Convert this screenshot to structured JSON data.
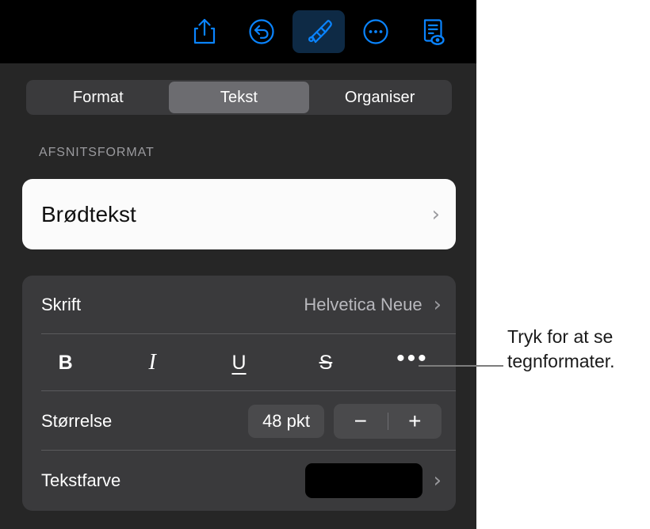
{
  "toolbar": {
    "buttons": [
      {
        "name": "share-icon",
        "label": "Del"
      },
      {
        "name": "undo-icon",
        "label": "Fortryd"
      },
      {
        "name": "paintbrush-icon",
        "label": "Format",
        "selected": true
      },
      {
        "name": "more-circle-icon",
        "label": "Mere"
      },
      {
        "name": "document-view-icon",
        "label": "Dokumentvisning"
      }
    ]
  },
  "segmented": {
    "options": [
      "Format",
      "Tekst",
      "Organiser"
    ],
    "selected": "Tekst",
    "selected_index": 1
  },
  "paragraph": {
    "section_label": "AFSNITSFORMAT",
    "style_name": "Brødtekst",
    "chevron": "›"
  },
  "text_card": {
    "font": {
      "label": "Skrift",
      "value": "Helvetica Neue",
      "chevron": "›"
    },
    "styles": [
      {
        "name": "bold-button",
        "glyph": "B"
      },
      {
        "name": "italic-button",
        "glyph": "I"
      },
      {
        "name": "underline-button",
        "glyph": "U"
      },
      {
        "name": "strikethrough-button",
        "glyph": "S"
      },
      {
        "name": "more-text-options-button",
        "glyph": "•••"
      }
    ],
    "size": {
      "label": "Størrelse",
      "value": "48 pkt",
      "decrement": "−",
      "increment": "+"
    },
    "color": {
      "label": "Tekstfarve",
      "swatch_color": "#000000",
      "chevron": "›"
    }
  },
  "callout": {
    "text": "Tryk for at se tegnformater."
  },
  "colors": {
    "panel_background": "#262626",
    "toolbar_background": "#000000",
    "card_background": "#3a3a3c",
    "card_white": "#fbfbfb",
    "accent": "#0a84ff",
    "segment_selected": "#6c6c70",
    "segment_track": "#3a3a3c",
    "control_background": "#4a4a4c"
  }
}
